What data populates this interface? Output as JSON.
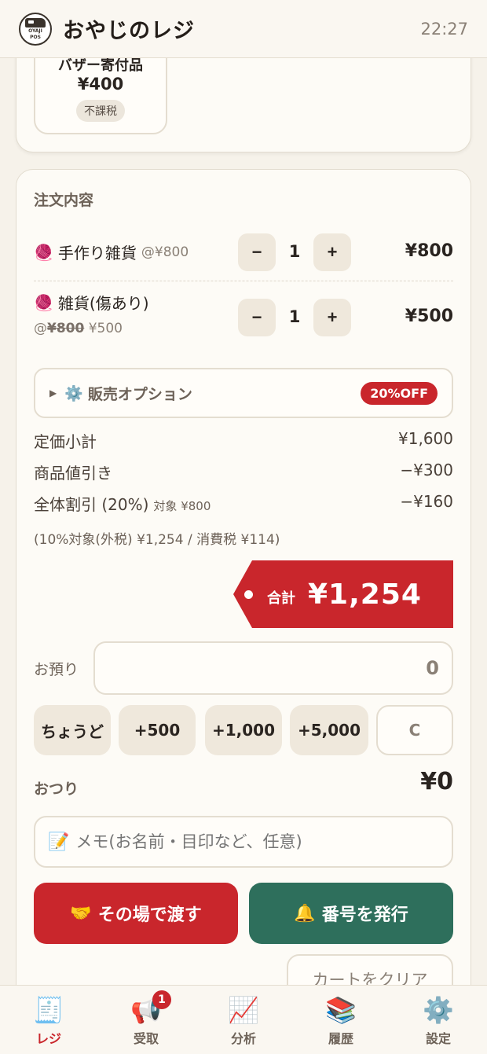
{
  "header": {
    "title": "おやじのレジ",
    "clock": "22:27",
    "logo_text_1": "OYAJI",
    "logo_text_2": "POS"
  },
  "product": {
    "name": "バザー寄付品",
    "price": "¥400",
    "tax": "不課税"
  },
  "order": {
    "title": "注文内容",
    "items": [
      {
        "emoji": "🧶",
        "name": "手作り雑貨",
        "unit": "@¥800",
        "qty": "1",
        "total": "¥800"
      },
      {
        "emoji": "🧶",
        "name": "雑貨(傷あり)",
        "unit_prefix": "@",
        "orig_price": "¥800",
        "unit": "¥500",
        "qty": "1",
        "total": "¥500"
      }
    ],
    "minus": "−",
    "plus": "+"
  },
  "options": {
    "arrow": "▶",
    "icon": "⚙️",
    "label": "販売オプション",
    "badge": "20%OFF"
  },
  "summary": {
    "list_subtotal_label": "定価小計",
    "list_subtotal": "¥1,600",
    "item_discount_label": "商品値引き",
    "item_discount": "−¥300",
    "overall_discount_label": "全体割引 (20%)",
    "overall_discount_target": "対象 ¥800",
    "overall_discount": "−¥160",
    "tax_line": "(10%対象(外税) ¥1,254 / 消費税 ¥114)"
  },
  "total": {
    "label": "合計",
    "value": "¥1,254"
  },
  "payment": {
    "deposit_label": "お預り",
    "deposit_value": "0",
    "quick": [
      "ちょうど",
      "+500",
      "+1,000",
      "+5,000",
      "C"
    ],
    "change_label": "おつり",
    "change_value": "¥0"
  },
  "memo": {
    "icon": "📝",
    "placeholder": "メモ(お名前・目印など、任意)"
  },
  "actions": {
    "handover_icon": "🤝",
    "handover": "その場で渡す",
    "ticket_icon": "🔔",
    "ticket": "番号を発行",
    "clear_cart": "カートをクリア"
  },
  "nav": [
    {
      "icon": "🧾",
      "label": "レジ"
    },
    {
      "icon": "📢",
      "label": "受取",
      "badge": "1"
    },
    {
      "icon": "📈",
      "label": "分析"
    },
    {
      "icon": "📚",
      "label": "履歴"
    },
    {
      "icon": "⚙️",
      "label": "設定"
    }
  ],
  "colors": {
    "accent_red": "#c9262c",
    "accent_green": "#2e6f5c",
    "background": "#f6f2ea"
  }
}
